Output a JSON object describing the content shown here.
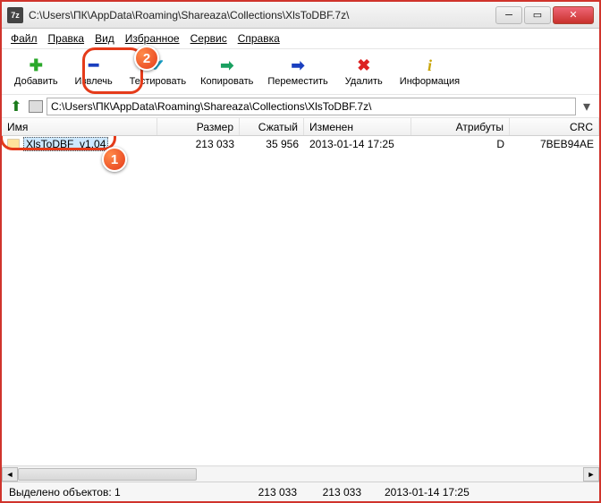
{
  "title": "C:\\Users\\ПК\\AppData\\Roaming\\Shareaza\\Collections\\XlsToDBF.7z\\",
  "app_icon_text": "7z",
  "menu": {
    "file": "Файл",
    "edit": "Правка",
    "view": "Вид",
    "favorites": "Избранное",
    "tools": "Сервис",
    "help": "Справка"
  },
  "toolbar": {
    "add": "Добавить",
    "extract": "Извлечь",
    "test": "Тестировать",
    "copy": "Копировать",
    "move": "Переместить",
    "delete": "Удалить",
    "info": "Информация"
  },
  "icons": {
    "add": "✚",
    "extract": "━",
    "test": "✔",
    "copy": "➡",
    "move": "➡",
    "delete": "✖",
    "info": "i",
    "up": "⬆"
  },
  "colors": {
    "add": "#2aa82a",
    "extract": "#1a3fbf",
    "test": "#1aa0c8",
    "copy": "#1aa060",
    "move": "#1a3fbf",
    "delete": "#d22",
    "info": "#c9a60b"
  },
  "path": "C:\\Users\\ПК\\AppData\\Roaming\\Shareaza\\Collections\\XlsToDBF.7z\\",
  "columns": {
    "name": "Имя",
    "size": "Размер",
    "packed": "Сжатый",
    "modified": "Изменен",
    "attr": "Атрибуты",
    "crc": "CRC"
  },
  "rows": [
    {
      "name": "XlsToDBF_v1.04",
      "size": "213 033",
      "packed": "35 956",
      "modified": "2013-01-14 17:25",
      "attr": "D",
      "crc": "7BEB94AE"
    }
  ],
  "status": {
    "selection": "Выделено объектов: 1",
    "size": "213 033",
    "packed": "213 033",
    "modified": "2013-01-14 17:25"
  },
  "badges": {
    "b1": "1",
    "b2": "2"
  }
}
